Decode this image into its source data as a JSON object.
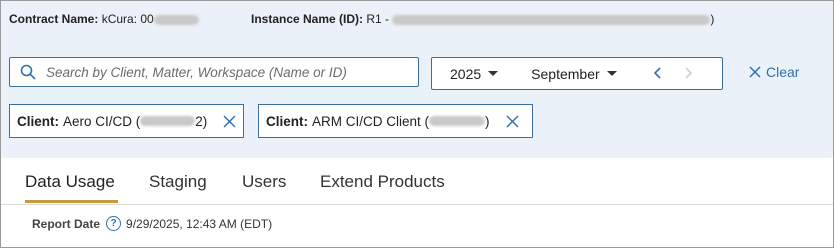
{
  "header": {
    "contract_label": "Contract Name:",
    "contract_value": "kCura: 00",
    "instance_label": "Instance Name (ID):",
    "instance_value": "R1 -",
    "instance_suffix": ")"
  },
  "search": {
    "placeholder": "Search by Client, Matter, Workspace (Name or ID)",
    "icon": "search-icon"
  },
  "period": {
    "year": "2025",
    "month": "September"
  },
  "clear": {
    "label": "Clear"
  },
  "filters": [
    {
      "label": "Client:",
      "value_prefix": "Aero CI/CD (",
      "value_suffix": "2)"
    },
    {
      "label": "Client:",
      "value_prefix": "ARM CI/CD Client (",
      "value_suffix": ")"
    }
  ],
  "tabs": [
    {
      "label": "Data Usage"
    },
    {
      "label": "Staging"
    },
    {
      "label": "Users"
    },
    {
      "label": "Extend Products"
    }
  ],
  "report": {
    "label": "Report Date",
    "help_glyph": "?",
    "value": "9/29/2025, 12:43 AM (EDT)"
  },
  "colors": {
    "background": "#eaf1f8",
    "accent_blue": "#2f6fb3",
    "tab_underline": "#c79a3a",
    "border": "#3e6f9c"
  }
}
